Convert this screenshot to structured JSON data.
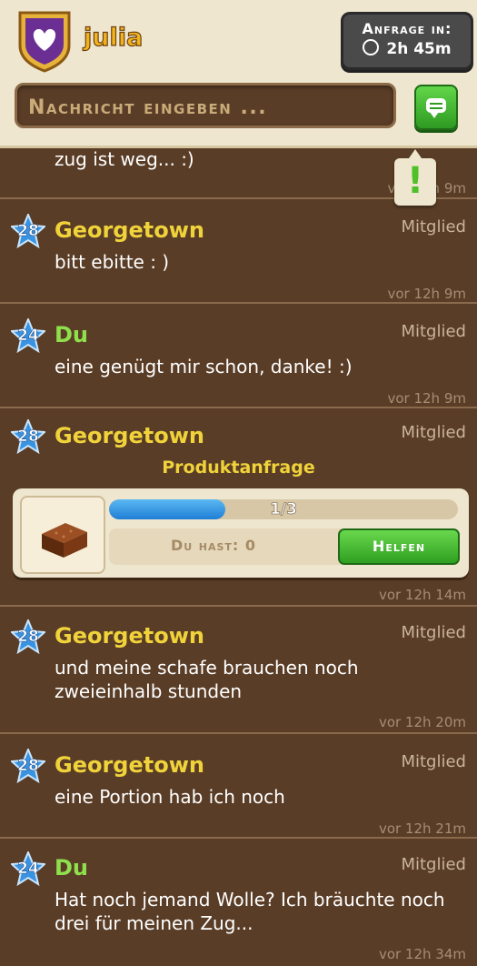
{
  "header": {
    "username": "julia",
    "request_label": "Anfrage in:",
    "request_time": "2h 45m",
    "input_placeholder": "Nachricht eingeben ...",
    "alert_symbol": "!"
  },
  "feed": {
    "partial_message": {
      "text": "zug ist weg... :)",
      "time": "vor 12h 9m"
    },
    "messages": [
      {
        "level": "28",
        "author": "Georgetown",
        "role": "Mitglied",
        "text": "bitt ebitte : )",
        "time": "vor 12h 9m",
        "self": false
      },
      {
        "level": "24",
        "author": "Du",
        "role": "Mitglied",
        "text": "eine genügt mir schon, danke! :)",
        "time": "vor 12h 9m",
        "self": true
      }
    ],
    "request_message": {
      "level": "28",
      "author": "Georgetown",
      "role": "Mitglied",
      "title": "Produktanfrage",
      "progress_text": "1/3",
      "progress_fraction": 0.3333,
      "have_label": "Du hast:",
      "have_value": "0",
      "help_label": "Helfen",
      "time": "vor 12h 14m",
      "item_icon": "brownie-icon"
    },
    "messages2": [
      {
        "level": "28",
        "author": "Georgetown",
        "role": "Mitglied",
        "text": "und meine schafe brauchen noch zweieinhalb stunden",
        "time": "vor 12h 20m",
        "self": false
      },
      {
        "level": "28",
        "author": "Georgetown",
        "role": "Mitglied",
        "text": "eine Portion hab ich noch",
        "time": "vor 12h 21m",
        "self": false
      },
      {
        "level": "24",
        "author": "Du",
        "role": "Mitglied",
        "text": "Hat noch jemand Wolle? Ich bräuchte noch drei für meinen Zug...",
        "time": "vor 12h 34m",
        "self": true
      }
    ]
  },
  "colors": {
    "background": "#5a3d26",
    "header": "#efe6cf",
    "name_other": "#f0d33a",
    "name_self": "#8ee04c",
    "button_green": "#2f9f22"
  }
}
